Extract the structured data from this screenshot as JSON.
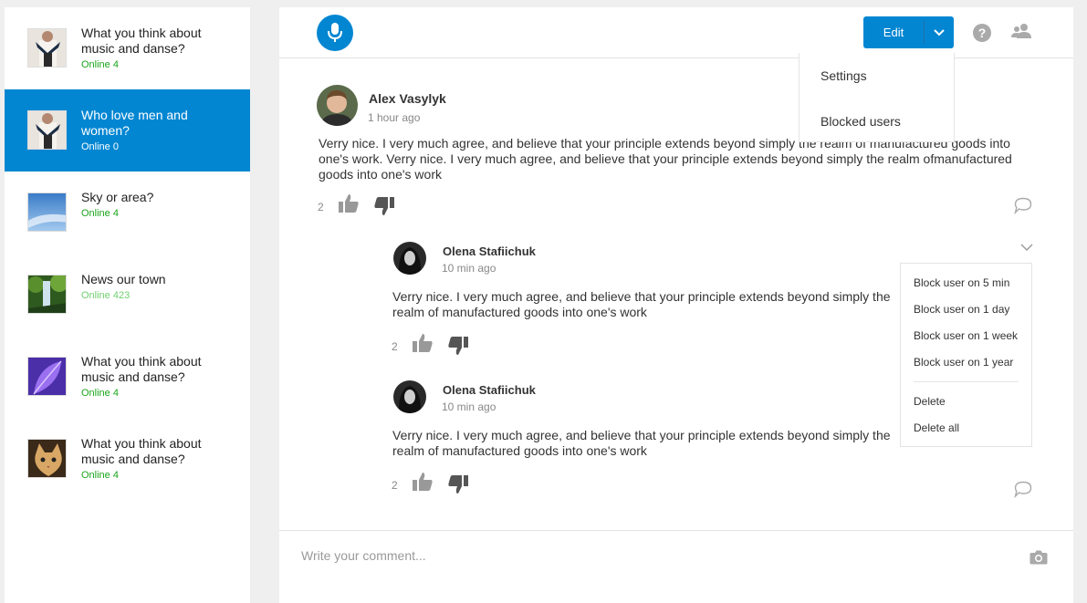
{
  "sidebar": {
    "rooms": [
      {
        "title": "What you think about music and danse?",
        "online": "Online 4"
      },
      {
        "title": "Who love men and women?",
        "online": "Online 0"
      },
      {
        "title": "Sky or area?",
        "online": "Online 4"
      },
      {
        "title": "News our town",
        "online": "Online 423"
      },
      {
        "title": "What you think about music and danse?",
        "online": "Online 4"
      },
      {
        "title": "What you think about music and danse?",
        "online": "Online 4"
      }
    ]
  },
  "toolbar": {
    "edit_label": "Edit",
    "settings_menu": [
      "Settings",
      "Blocked users"
    ]
  },
  "posts": [
    {
      "author": "Alex Vasylyk",
      "time": "1 hour ago",
      "text": "Verry nice. I very much agree, and believe that your principle extends beyond simply the realm of manufactured goods into one's work. Verry nice. I very much agree, and believe that your principle extends beyond simply the realm ofmanufactured goods into one's work",
      "likes": "2"
    },
    {
      "author": "Olena Stafiichuk",
      "time": "10 min ago",
      "text": "Verry nice. I very much agree, and believe that your principle extends beyond simply the realm of manufactured goods into one's work",
      "likes": "2"
    },
    {
      "author": "Olena Stafiichuk",
      "time": "10 min ago",
      "text": "Verry nice. I very much agree, and believe that your principle extends beyond simply the realm of manufactured goods into one's work",
      "likes": "2"
    }
  ],
  "block_menu": {
    "items": [
      "Block user on 5 min",
      "Block user on 1 day",
      "Block user on  1 week",
      "Block user on 1 year"
    ],
    "actions": [
      "Delete",
      "Delete all"
    ]
  },
  "composer": {
    "placeholder": "Write your comment..."
  },
  "colors": {
    "accent": "#0386d2",
    "online": "#1aa51a"
  }
}
